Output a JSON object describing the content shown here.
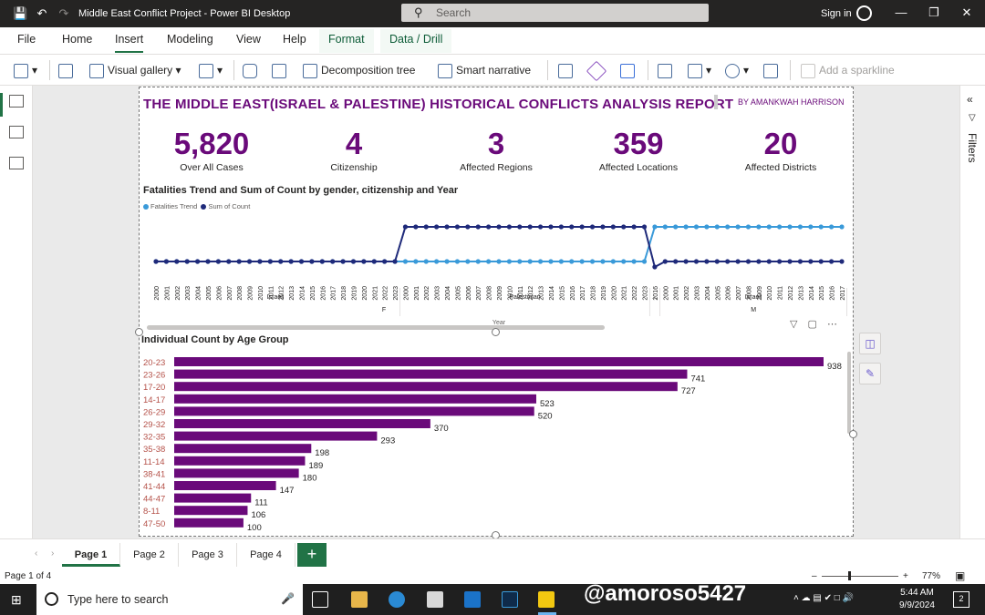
{
  "window": {
    "title": "Middle East Conflict Project - Power BI Desktop",
    "search_placeholder": "Search",
    "signin_label": "Sign in"
  },
  "menu": {
    "items": [
      "File",
      "Home",
      "Insert",
      "Modeling",
      "View",
      "Help"
    ],
    "active": "Insert",
    "contextual": [
      "Format",
      "Data / Drill"
    ]
  },
  "ribbon": {
    "visual_gallery": "Visual gallery",
    "decomposition_tree": "Decomposition tree",
    "smart_narrative": "Smart narrative",
    "add_sparkline": "Add a sparkline"
  },
  "filters_label": "Filters",
  "report": {
    "title": "THE MIDDLE EAST(ISRAEL & PALESTINE) HISTORICAL CONFLICTS ANALYSIS REPORT",
    "byline": "BY AMANKWAH HARRISON",
    "kpis": [
      {
        "value": "5,820",
        "label": "Over All Cases"
      },
      {
        "value": "4",
        "label": "Citizenship"
      },
      {
        "value": "3",
        "label": "Affected Regions"
      },
      {
        "value": "359",
        "label": "Affected Locations"
      },
      {
        "value": "20",
        "label": "Affected Districts"
      }
    ]
  },
  "chart_data": [
    {
      "type": "line",
      "title": "Fatalities Trend and Sum of Count by gender, citizenship and Year",
      "xlabel": "Year",
      "legend": [
        "Fatalities Trend",
        "Sum of Count"
      ],
      "legend_position": "top-left",
      "colors": {
        "Fatalities Trend": "#3a9ad9",
        "Sum of Count": "#1f2a7a"
      },
      "x_groups": [
        {
          "label": "Israeli",
          "years": [
            "2000",
            "2001",
            "2002",
            "2003",
            "2004",
            "2005",
            "2006",
            "2007",
            "2008",
            "2009",
            "2010",
            "2011",
            "2012",
            "2013",
            "2014",
            "2015",
            "2016",
            "2017",
            "2018",
            "2019",
            "2020",
            "2021",
            "2022",
            "2023"
          ]
        },
        {
          "label": "Palestinian",
          "years": [
            "2000",
            "2001",
            "2002",
            "2003",
            "2004",
            "2005",
            "2006",
            "2007",
            "2008",
            "2009",
            "2010",
            "2011",
            "2012",
            "2013",
            "2014",
            "2015",
            "2016",
            "2017",
            "2018",
            "2019",
            "2020",
            "2021",
            "2022",
            "2023"
          ]
        },
        {
          "label": "...",
          "years": [
            "2016"
          ]
        },
        {
          "label": "Israeli",
          "years": [
            "2000",
            "2001",
            "2002",
            "2003",
            "2004",
            "2005",
            "2006",
            "2007",
            "2008",
            "2009",
            "2010",
            "2011",
            "2012",
            "2013",
            "2014",
            "2015",
            "2016",
            "2017"
          ]
        }
      ],
      "gender_groups": [
        {
          "label": "F",
          "span": 49
        },
        {
          "label": "M",
          "span": 18
        }
      ],
      "series": [
        {
          "name": "Fatalities Trend",
          "level": "low",
          "switch_at_index": 48
        },
        {
          "name": "Sum of Count",
          "level": "low",
          "switch_at_index": 24
        }
      ]
    },
    {
      "type": "bar",
      "orientation": "horizontal",
      "title": "Individual Count by Age Group",
      "categories": [
        "20-23",
        "23-26",
        "17-20",
        "14-17",
        "26-29",
        "29-32",
        "32-35",
        "35-38",
        "11-14",
        "38-41",
        "41-44",
        "44-47",
        "8-11",
        "47-50"
      ],
      "values": [
        938,
        741,
        727,
        523,
        520,
        370,
        293,
        198,
        189,
        180,
        147,
        111,
        106,
        100
      ],
      "bar_color": "#6a0a7a",
      "label_color": "#b5524a"
    }
  ],
  "pages": {
    "tabs": [
      "Page 1",
      "Page 2",
      "Page 3",
      "Page 4"
    ],
    "active": "Page 1",
    "info": "Page 1 of 4",
    "zoom": "77%"
  },
  "taskbar": {
    "search_placeholder": "Type here to search",
    "time": "5:44 AM",
    "date": "9/9/2024",
    "notification_count": "2",
    "overlay_text": "@amoroso5427"
  }
}
